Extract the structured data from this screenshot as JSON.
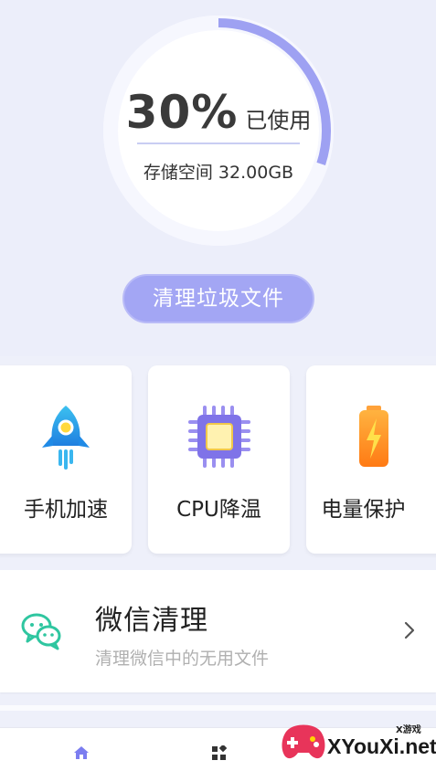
{
  "storage": {
    "used_percent_text": "30%",
    "used_fraction": 0.3,
    "used_label": "已使用",
    "capacity_text": "存储空间 32.00GB"
  },
  "clean_button": {
    "label": "清理垃圾文件"
  },
  "tools": [
    {
      "label": "手机加速",
      "icon": "rocket-icon"
    },
    {
      "label": "CPU降温",
      "icon": "cpu-chip-icon"
    },
    {
      "label": "电量保护",
      "icon": "battery-icon"
    }
  ],
  "wechat_clean": {
    "title": "微信清理",
    "subtitle": "清理微信中的无用文件",
    "icon": "wechat-icon"
  },
  "bottom_nav": [
    {
      "icon": "home-icon",
      "active": true
    },
    {
      "icon": "apps-grid-icon",
      "active": false
    }
  ],
  "watermark": {
    "brand": "XYouXi.net",
    "small": "X游戏"
  },
  "colors": {
    "accent": "#a3a6f4",
    "ring_progress": "#9ea1f2",
    "ring_track": "#f7f8fe",
    "background": "#eceefa",
    "wechat_green": "#2fc6a0",
    "battery_orange": "#ff8a1f"
  }
}
